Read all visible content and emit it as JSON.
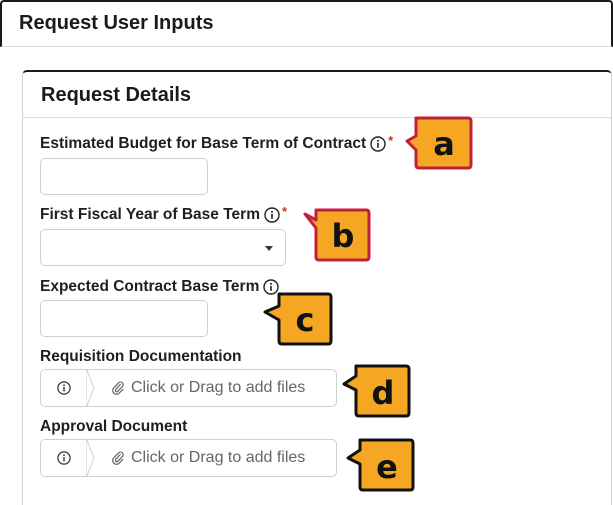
{
  "page": {
    "title": "Request User Inputs"
  },
  "card": {
    "title": "Request Details"
  },
  "fields": {
    "budget": {
      "label": "Estimated Budget for Base Term of Contract",
      "required_mark": "*",
      "value": ""
    },
    "fiscal_year": {
      "label": "First Fiscal Year of Base Term",
      "required_mark": "*",
      "value": ""
    },
    "base_term": {
      "label": "Expected Contract Base Term",
      "value": ""
    },
    "requisition": {
      "label": "Requisition Documentation",
      "drop_text": "Click or Drag to add files"
    },
    "approval": {
      "label": "Approval Document",
      "drop_text": "Click or Drag to add files"
    }
  },
  "callouts": {
    "a": "a",
    "b": "b",
    "c": "c",
    "d": "d",
    "e": "e"
  },
  "colors": {
    "callout_fill": "#f5a623",
    "callout_border_red": "#c0203a",
    "callout_border_black": "#111111",
    "required": "#c0392b"
  },
  "icons": [
    "info-icon",
    "paperclip-icon",
    "caret-down-icon"
  ]
}
